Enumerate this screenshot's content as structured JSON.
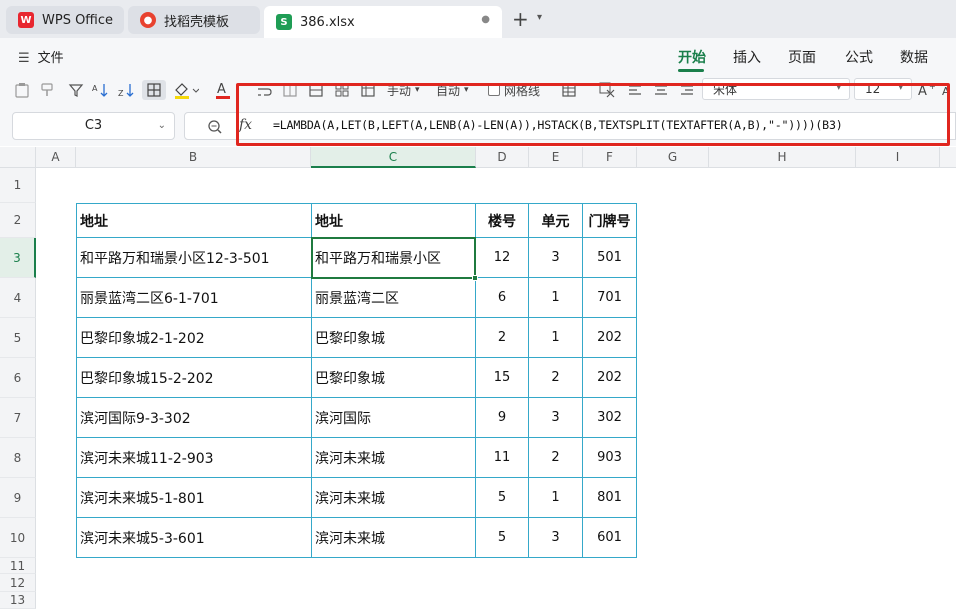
{
  "tabs": [
    {
      "label": "WPS Office",
      "icon": "wps-logo-icon"
    },
    {
      "label": "找稻壳模板",
      "icon": "docer-icon"
    },
    {
      "label": "386.xlsx",
      "icon": "spreadsheet-icon",
      "close": "●"
    }
  ],
  "new_tab": "+",
  "menu": {
    "file": "文件",
    "ribbon_tabs": [
      "开始",
      "插入",
      "页面",
      "公式",
      "数据"
    ],
    "active_tab": "开始"
  },
  "toolbar": {
    "manual_label": "手动",
    "auto_label": "自动",
    "gridlines_label": "网格线",
    "font_name": "宋体",
    "font_size": "12"
  },
  "formula_bar": {
    "cell_ref": "C3",
    "fx": "fx",
    "formula": "=LAMBDA(A,LET(B,LEFT(A,LENB(A)-LEN(A)),HSTACK(B,TEXTSPLIT(TEXTAFTER(A,B),\"-\"))))(B3)"
  },
  "columns": [
    "A",
    "B",
    "C",
    "D",
    "E",
    "F",
    "G",
    "H",
    "I"
  ],
  "rows": [
    "1",
    "2",
    "3",
    "4",
    "5",
    "6",
    "7",
    "8",
    "9",
    "10",
    "11",
    "12",
    "13"
  ],
  "table": {
    "headers": [
      "地址",
      "地址",
      "楼号",
      "单元",
      "门牌号"
    ],
    "rows": [
      [
        "和平路万和瑞景小区12-3-501",
        "和平路万和瑞景小区",
        "12",
        "3",
        "501"
      ],
      [
        "丽景蓝湾二区6-1-701",
        "丽景蓝湾二区",
        "6",
        "1",
        "701"
      ],
      [
        "巴黎印象城2-1-202",
        "巴黎印象城",
        "2",
        "1",
        "202"
      ],
      [
        "巴黎印象城15-2-202",
        "巴黎印象城",
        "15",
        "2",
        "202"
      ],
      [
        "滨河国际9-3-302",
        "滨河国际",
        "9",
        "3",
        "302"
      ],
      [
        "滨河未来城11-2-903",
        "滨河未来城",
        "11",
        "2",
        "903"
      ],
      [
        "滨河未来城5-1-801",
        "滨河未来城",
        "5",
        "1",
        "801"
      ],
      [
        "滨河未来城5-3-601",
        "滨河未来城",
        "5",
        "3",
        "601"
      ]
    ]
  },
  "colors": {
    "accent": "#1a7f4b",
    "table_border": "#35a8c9",
    "highlight_box": "#e0261f"
  }
}
